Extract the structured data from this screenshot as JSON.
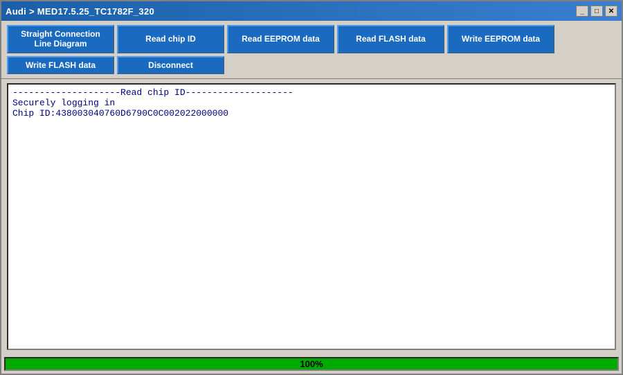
{
  "titleBar": {
    "title": "Audi  >  MED17.5.25_TC1782F_320",
    "minimizeLabel": "_",
    "maximizeLabel": "□",
    "closeLabel": "✕"
  },
  "toolbar": {
    "row1": [
      {
        "id": "btn-diagram",
        "label": "Straight Connection\nLine Diagram"
      },
      {
        "id": "btn-read-chip",
        "label": "Read chip ID"
      },
      {
        "id": "btn-read-eeprom",
        "label": "Read EEPROM data"
      },
      {
        "id": "btn-read-flash",
        "label": "Read FLASH data"
      },
      {
        "id": "btn-write-eeprom",
        "label": "Write EEPROM data"
      }
    ],
    "row2": [
      {
        "id": "btn-write-flash",
        "label": "Write FLASH data"
      },
      {
        "id": "btn-disconnect",
        "label": "Disconnect"
      }
    ]
  },
  "output": {
    "text": "--------------------Read chip ID--------------------\nSecurely logging in\nChip ID:438003040760D6790C0C002022000000"
  },
  "statusBar": {
    "progressPercent": 100,
    "progressLabel": "100%"
  }
}
